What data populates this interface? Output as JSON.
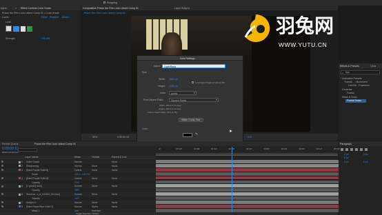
{
  "top": {
    "snapping_label": "Snapping",
    "project_tab": "roject",
    "effect_controls_tab": "Effect Controls Color Grade",
    "composition_tab": "Composition Prison the Film Look Linked Comp 01",
    "layer_tab": "Layer Subject",
    "viewer_subtab": "Prison the Film Look Linked Comp 01"
  },
  "effect_controls": {
    "breadcrumb": "Prison the Film Look Linked Comp 01 • Color Grade",
    "fx_label": "Looks",
    "reset": "Reset",
    "register": "Register",
    "about": "About...",
    "look_label": "Look",
    "strength_label": "Strength",
    "strength_value": "100.0%"
  },
  "viewer": {
    "zoom": "50%",
    "timecode": "0:00:00:10",
    "exposure": "+0.0"
  },
  "watermark": {
    "brand": "羽兔网",
    "url": "WWW.YUTU.CN",
    "color": "#ffffff"
  },
  "dialog": {
    "title": "Solid Settings",
    "name_label": "Name:",
    "name_value": "Light Rays",
    "size_section": "Size",
    "width_label": "Width:",
    "width_value": "3840 px",
    "lock_label": "Lock Aspect Ratio to 16:9 (1.78)",
    "height_label": "Height:",
    "height_value": "2160 px",
    "units_label": "Units:",
    "units_value": "pixels",
    "par_label": "Pixel Aspect Ratio:",
    "par_value": "Square Pixels",
    "info_width": "Width: 100.0 % of comp",
    "info_height": "Height: 100.0 % of comp",
    "info_frame": "Frame Aspect Ratio: 16:9 (1.78)",
    "make_comp_size": "Make Comp Size",
    "color_section": "Color",
    "preview_label": "Preview",
    "cancel": "Cancel",
    "ok": "OK"
  },
  "right_panel": {
    "tab_effects": "Effects & Presets",
    "tab_libraries": "Libra",
    "search_value": "frac",
    "tree": [
      "* Animation Presets",
      "Transiti... - Movement",
      "Card W... Fractured",
      "Generate",
      "Fractal",
      "Noise & Grain",
      "Fractal Noise"
    ],
    "paragraph_tab": "Paragraph",
    "para_values": [
      "0 px",
      "0 px",
      "0 px",
      "0 px",
      "0 px"
    ]
  },
  "timeline": {
    "render_queue_tab": "Render Queue",
    "comp_tab": "Prison the Film Look Linked Comp 01",
    "timecode": "0:00:00:10",
    "frame_info": "00010 (24.00 fps)",
    "col_source": "Layer Name",
    "col_mode": "Mode",
    "col_trkmat": "TrkMat",
    "col_parent": "Parent & Link",
    "toggle_footer": "Toggle Switches / Modes",
    "ruler": [
      "0f",
      "00:12f",
      "01:00f",
      "01:12f",
      "02:00f",
      "02:12f",
      "03:00f",
      "03:12f",
      "04:00f",
      "04:12f",
      "05:00f"
    ],
    "rows": [
      {
        "num": "1",
        "name": "Color Grade",
        "mode": "Norma",
        "trk": "",
        "parent": "None",
        "color": "#a4a4a4"
      },
      {
        "num": "2",
        "name": "Sharpening",
        "mode": "Norma",
        "trk": "None",
        "parent": "None",
        "color": "#a4a4a4"
      },
      {
        "num": "3",
        "name": "[Dark Purple Solid 8]",
        "mode": "Overla",
        "trk": "None",
        "parent": "None",
        "color": "#b34a5a"
      },
      {
        "num": "",
        "name": "Scale",
        "mode": "100.0, 116.0%",
        "trk": "",
        "parent": "",
        "color": ""
      },
      {
        "num": "4",
        "name": "[Dark Purple Solid 8]",
        "mode": "Overla",
        "trk": "None",
        "parent": "None",
        "color": "#b34a5a"
      },
      {
        "num": "",
        "name": "Opacity",
        "mode": "20%",
        "trk": "",
        "parent": "",
        "color": ""
      },
      {
        "num": "5",
        "name": "[1 (part2).mov]",
        "mode": "Screen",
        "trk": "None",
        "parent": "None",
        "color": "#9ea8b8"
      },
      {
        "num": "",
        "name": "Opacity",
        "mode": "15%",
        "trk": "",
        "parent": "",
        "color": ""
      },
      {
        "num": "6",
        "name": "Slovena...c_a_0.DON_Ch.mov]",
        "mode": "Screen",
        "trk": "None",
        "parent": "None",
        "color": "#9ea8b8"
      },
      {
        "num": "",
        "name": "Opacity",
        "mode": "15%",
        "trk": "",
        "parent": "",
        "color": ""
      },
      {
        "num": "7",
        "name": "Subject 2",
        "mode": "Norma",
        "trk": "None",
        "parent": "None",
        "color": "#a4a4a4"
      },
      {
        "num": "8",
        "name": "[Dark Royal Blue Solid 2]",
        "mode": "Norma",
        "trk": "Alpha",
        "parent": "None",
        "color": "#4a6bb3"
      },
      {
        "num": "",
        "name": "Mask 1",
        "mode": "Add",
        "trk": "Inverted",
        "parent": "",
        "color": ""
      }
    ],
    "track_colors": [
      "#7a7a7a",
      "#8a8a8a",
      "#8e3a45",
      "#5a5a5a",
      "#8e3a45",
      "#5a5a5a",
      "#9aa09c",
      "#5a5a5a",
      "#9aa09c",
      "#5a5a5a",
      "#7a7a7a",
      "#8e3a45",
      "#5a5a5a"
    ]
  }
}
